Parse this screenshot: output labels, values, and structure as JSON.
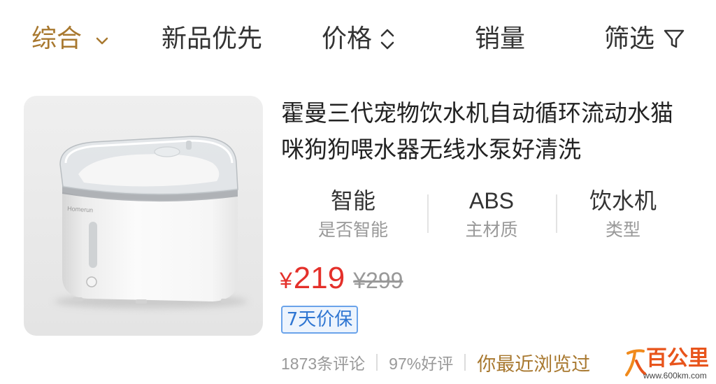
{
  "colors": {
    "accent": "#a8782f",
    "text": "#333333",
    "muted": "#999999",
    "price": "#e4302a",
    "badge_border": "#6aa3ea",
    "badge_text": "#2f76d2",
    "badge_bg": "#edf4fd",
    "watermark": "#e8541b"
  },
  "sort_bar": {
    "tabs": [
      {
        "label": "综合",
        "active": true,
        "icon": "chevron-down-icon"
      },
      {
        "label": "新品优先",
        "active": false
      },
      {
        "label": "价格",
        "active": false,
        "icon": "sort-arrows-icon"
      },
      {
        "label": "销量",
        "active": false
      },
      {
        "label": "筛选",
        "active": false,
        "icon": "filter-icon"
      }
    ]
  },
  "product": {
    "image_logo_text": "Homerun",
    "title": "霍曼三代宠物饮水机自动循环流动水猫咪狗狗喂水器无线水泵好清洗",
    "attributes": [
      {
        "value": "智能",
        "label": "是否智能"
      },
      {
        "value": "ABS",
        "label": "主材质"
      },
      {
        "value": "饮水机",
        "label": "类型"
      }
    ],
    "price": {
      "currency": "¥",
      "current": "219",
      "original": "¥299"
    },
    "badge": "7天价保",
    "stats": {
      "reviews": "1873条评论",
      "positive_rate": "97%好评",
      "history": "你最近浏览过"
    }
  },
  "watermark": {
    "name": "百公里",
    "url": "www.600km.com"
  }
}
